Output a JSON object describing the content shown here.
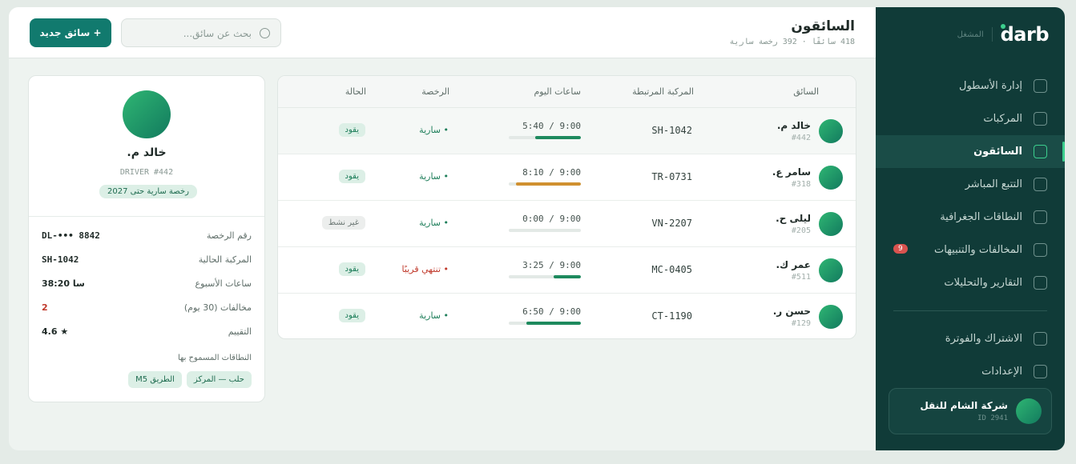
{
  "brand": {
    "logo": "darb",
    "sub": "المشغل"
  },
  "sidebar": {
    "items": [
      {
        "label": "إدارة الأسطول"
      },
      {
        "label": "المركبات"
      },
      {
        "label": "السائقون"
      },
      {
        "label": "التتبع المباشر"
      },
      {
        "label": "النطاقات الجغرافية"
      },
      {
        "label": "المخالفات والتنبيهات",
        "badge": "9"
      },
      {
        "label": "التقارير والتحليلات"
      }
    ],
    "bottom_items": [
      {
        "label": "الاشتراك والفوترة"
      },
      {
        "label": "الإعدادات"
      }
    ],
    "company": {
      "name": "شركة الشام للنقل",
      "id": "ID 2941"
    }
  },
  "header": {
    "title": "السائقون",
    "subtitle": "418 سائقًا · 392 رخصة سارية",
    "search_placeholder": "بحث عن سائق...",
    "add_label": "+ سائق جديد"
  },
  "table": {
    "columns": [
      "السائق",
      "المركبة المرتبطة",
      "ساعات اليوم",
      "الرخصة",
      "الحالة"
    ],
    "rows": [
      {
        "name": "خالد م.",
        "id": "#442",
        "vehicle": "SH-1042",
        "hours": "5:40 / 9:00",
        "progress": 0.63,
        "bar_color": "#1e8a5e",
        "license": "• سارية",
        "license_state": "ok",
        "status": "يقود",
        "status_state": "on"
      },
      {
        "name": "سامر ع.",
        "id": "#318",
        "vehicle": "TR-0731",
        "hours": "8:10 / 9:00",
        "progress": 0.9,
        "bar_color": "#d0902f",
        "license": "• سارية",
        "license_state": "ok",
        "status": "يقود",
        "status_state": "on"
      },
      {
        "name": "ليلى ح.",
        "id": "#205",
        "vehicle": "VN-2207",
        "hours": "0:00 / 9:00",
        "progress": 0,
        "bar_color": "#1e8a5e",
        "license": "• سارية",
        "license_state": "ok",
        "status": "غير نشط",
        "status_state": "off"
      },
      {
        "name": "عمر ك.",
        "id": "#511",
        "vehicle": "MC-0405",
        "hours": "3:25 / 9:00",
        "progress": 0.38,
        "bar_color": "#1e8a5e",
        "license": "• تنتهي قريبًا",
        "license_state": "warn",
        "status": "يقود",
        "status_state": "on"
      },
      {
        "name": "حسن ر.",
        "id": "#129",
        "vehicle": "CT-1190",
        "hours": "6:50 / 9:00",
        "progress": 0.76,
        "bar_color": "#1e8a5e",
        "license": "• سارية",
        "license_state": "ok",
        "status": "يقود",
        "status_state": "on"
      }
    ]
  },
  "profile": {
    "name": "خالد م.",
    "code": "DRIVER #442",
    "license_badge": "رخصة سارية حتى 2027",
    "fields": [
      {
        "label": "رقم الرخصة",
        "value": "DL-••• 8842"
      },
      {
        "label": "المركبة الحالية",
        "value": "SH-1042"
      },
      {
        "label": "ساعات الأسبوع",
        "value": "38:20 سا"
      },
      {
        "label": "مخالفات (30 يوم)",
        "value": "2",
        "highlight": "red"
      },
      {
        "label": "التقييم",
        "value": "4.6 ★"
      }
    ],
    "zones_title": "النطاقات المسموح بها",
    "zones": [
      "حلب — المركز",
      "الطريق M5"
    ]
  }
}
